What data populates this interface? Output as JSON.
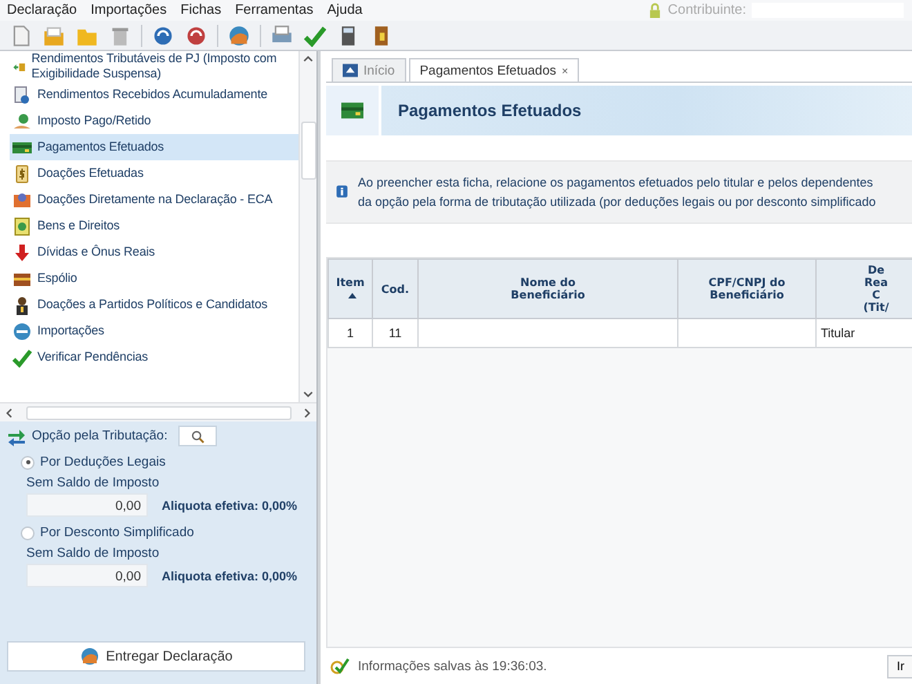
{
  "menu": [
    "Declaração",
    "Importações",
    "Fichas",
    "Ferramentas",
    "Ajuda"
  ],
  "contribuinte": {
    "label": "Contribuinte:"
  },
  "sidebar": {
    "items": [
      {
        "label": "Rendimentos Tributáveis de PJ (Imposto com Exigibilidade Suspensa)",
        "selected": false
      },
      {
        "label": "Rendimentos Recebidos Acumuladamente",
        "selected": false
      },
      {
        "label": "Imposto Pago/Retido",
        "selected": false
      },
      {
        "label": "Pagamentos Efetuados",
        "selected": true
      },
      {
        "label": "Doações Efetuadas",
        "selected": false
      },
      {
        "label": "Doações Diretamente na Declaração - ECA",
        "selected": false
      },
      {
        "label": "Bens e Direitos",
        "selected": false
      },
      {
        "label": "Dívidas e Ônus Reais",
        "selected": false
      },
      {
        "label": "Espólio",
        "selected": false
      },
      {
        "label": "Doações a Partidos Políticos e Candidatos",
        "selected": false
      },
      {
        "label": "Importações",
        "selected": false
      },
      {
        "label": "Verificar Pendências",
        "selected": false
      }
    ]
  },
  "tributacao": {
    "title": "Opção pela Tributação:",
    "options": [
      {
        "label": "Por Deduções Legais",
        "selected": true,
        "sublabel": "Sem Saldo de Imposto",
        "value": "0,00",
        "aliquota": "Aliquota efetiva: 0,00%"
      },
      {
        "label": "Por Desconto Simplificado",
        "selected": false,
        "sublabel": "Sem Saldo de Imposto",
        "value": "0,00",
        "aliquota": "Aliquota efetiva: 0,00%"
      }
    ],
    "submit": "Entregar Declaração"
  },
  "tabs": [
    {
      "label": "Início",
      "selected": false,
      "closable": false
    },
    {
      "label": "Pagamentos Efetuados",
      "selected": true,
      "closable": true,
      "close": "×"
    }
  ],
  "page_title": "Pagamentos Efetuados",
  "info": [
    "Ao preencher esta ficha, relacione os pagamentos efetuados pelo titular e pelos dependentes",
    "da opção pela forma de tributação utilizada (por deduções legais ou por desconto simplificado"
  ],
  "table": {
    "columns": [
      {
        "label": "Item",
        "sorted": true
      },
      {
        "label": "Cod.",
        "sorted": false
      },
      {
        "label": "Nome do\nBeneficiário",
        "sorted": false
      },
      {
        "label": "CPF/CNPJ do\nBeneficiário",
        "sorted": false
      },
      {
        "label": "De\nRea\nC\n(Tit/",
        "sorted": false
      }
    ],
    "rows": [
      [
        "1",
        "11",
        "",
        "",
        "Titular"
      ]
    ]
  },
  "status": {
    "text": "Informações salvas às 19:36:03.",
    "button": "Ir"
  }
}
